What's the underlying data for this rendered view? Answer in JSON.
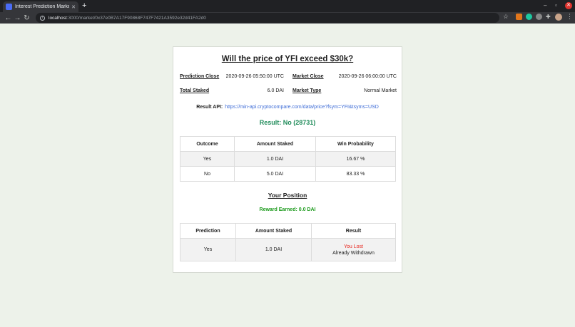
{
  "browser": {
    "tab_title": "Interest Prediction Marke",
    "tab_close": "✕",
    "new_tab": "+",
    "url_host": "localhost",
    "url_path": ":3000/market/0x37e0B7A17F90868F747F7421A3592e32d41FA2d0",
    "window_min": "–",
    "window_max": "▫",
    "window_close": "✕"
  },
  "market": {
    "title": "Will the price of YFI exceed $30k?",
    "prediction_close_label": "Prediction Close",
    "prediction_close_value": "2020-09-26 05:50:00 UTC",
    "market_close_label": "Market Close",
    "market_close_value": "2020-09-26 06:00:00 UTC",
    "total_staked_label": "Total Staked",
    "total_staked_value": "6.0 DAI",
    "market_type_label": "Market Type",
    "market_type_value": "Normal Market",
    "result_api_label": "Result API:",
    "result_api_url": "https://min-api.cryptocompare.com/data/price?fsym=YFI&tsyms=USD",
    "result": "Result: No (28731)"
  },
  "outcomes_table": {
    "headers": [
      "Outcome",
      "Amount Staked",
      "Win Probability"
    ],
    "rows": [
      [
        "Yes",
        "1.0 DAI",
        "16.67 %"
      ],
      [
        "No",
        "5.0 DAI",
        "83.33 %"
      ]
    ]
  },
  "position": {
    "heading": "Your Position",
    "reward": "Reward Earned: 0.0 DAI",
    "headers": [
      "Prediction",
      "Amount Staked",
      "Result"
    ],
    "rows": [
      {
        "prediction": "Yes",
        "amount": "1.0 DAI",
        "result_status": "You Lost",
        "result_note": "Already Withdrawn"
      }
    ]
  },
  "colors": {
    "result_green": "#218c5b",
    "reward_green": "#1b9a1b",
    "lost_red": "#e8261e",
    "link_blue": "#3c6bd6",
    "page_background": "#edf2ea"
  },
  "icons": [
    "info-icon",
    "star-icon",
    "metamask-fox-icon",
    "extension-icon",
    "puzzle-icon",
    "avatar",
    "menu-icon",
    "back-icon",
    "forward-icon",
    "reload-icon"
  ]
}
